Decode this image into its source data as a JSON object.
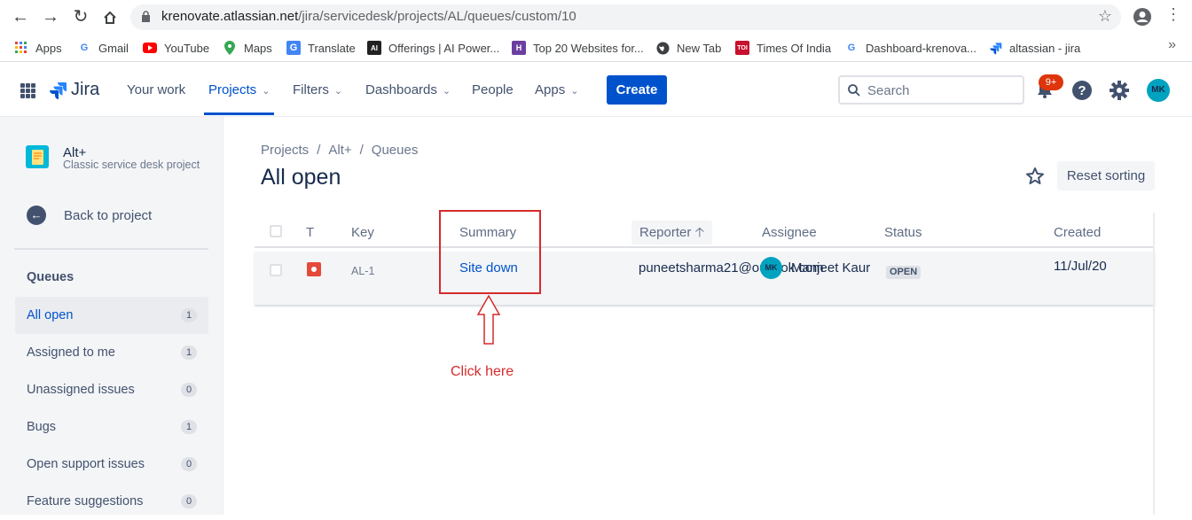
{
  "browser": {
    "url_host": "krenovate.atlassian.net",
    "url_path": "/jira/servicedesk/projects/AL/queues/custom/10",
    "bookmarks": [
      {
        "label": "Apps",
        "icon": "apps-grid-icon"
      },
      {
        "label": "Gmail",
        "icon": "google-icon"
      },
      {
        "label": "YouTube",
        "icon": "youtube-icon"
      },
      {
        "label": "Maps",
        "icon": "maps-pin-icon"
      },
      {
        "label": "Translate",
        "icon": "translate-icon"
      },
      {
        "label": "Offerings | AI Power...",
        "icon": "offerings-icon"
      },
      {
        "label": "Top 20 Websites for...",
        "icon": "top20-icon"
      },
      {
        "label": "New Tab",
        "icon": "globe-icon"
      },
      {
        "label": "Times Of India",
        "icon": "toi-icon"
      },
      {
        "label": "Dashboard-krenova...",
        "icon": "google-icon"
      },
      {
        "label": "altassian - jira",
        "icon": "jira-icon"
      }
    ],
    "more": "»"
  },
  "topbar": {
    "logo_text": "Jira",
    "nav": [
      {
        "label": "Your work",
        "chevron": false
      },
      {
        "label": "Projects",
        "chevron": true,
        "active": true
      },
      {
        "label": "Filters",
        "chevron": true
      },
      {
        "label": "Dashboards",
        "chevron": true
      },
      {
        "label": "People",
        "chevron": false
      },
      {
        "label": "Apps",
        "chevron": true
      }
    ],
    "create_label": "Create",
    "search_placeholder": "Search",
    "notifications_badge": "9+",
    "user_initials": "MK",
    "accent_color": "#0052cc"
  },
  "sidebar": {
    "project_name": "Alt+",
    "project_type": "Classic service desk project",
    "back_label": "Back to project",
    "queues_heading": "Queues",
    "queues": [
      {
        "label": "All open",
        "count": "1",
        "selected": true
      },
      {
        "label": "Assigned to me",
        "count": "1"
      },
      {
        "label": "Unassigned issues",
        "count": "0"
      },
      {
        "label": "Bugs",
        "count": "1"
      },
      {
        "label": "Open support issues",
        "count": "0"
      },
      {
        "label": "Feature suggestions",
        "count": "0"
      }
    ]
  },
  "main": {
    "breadcrumb": [
      "Projects",
      "Alt+",
      "Queues"
    ],
    "title": "All open",
    "reset_label": "Reset sorting",
    "columns": {
      "type": "T",
      "key": "Key",
      "summary": "Summary",
      "reporter": "Reporter",
      "assignee": "Assignee",
      "status": "Status",
      "created": "Created"
    },
    "rows": [
      {
        "type_icon": "bug-icon",
        "key": "AL-1",
        "summary": "Site down",
        "reporter": "puneetsharma21@outlook.com",
        "assignee_initials": "MK",
        "assignee": "Manjeet Kaur",
        "status": "OPEN",
        "created": "11/Jul/20"
      }
    ]
  },
  "annotation": {
    "text": "Click here",
    "color": "#d42b2b"
  }
}
